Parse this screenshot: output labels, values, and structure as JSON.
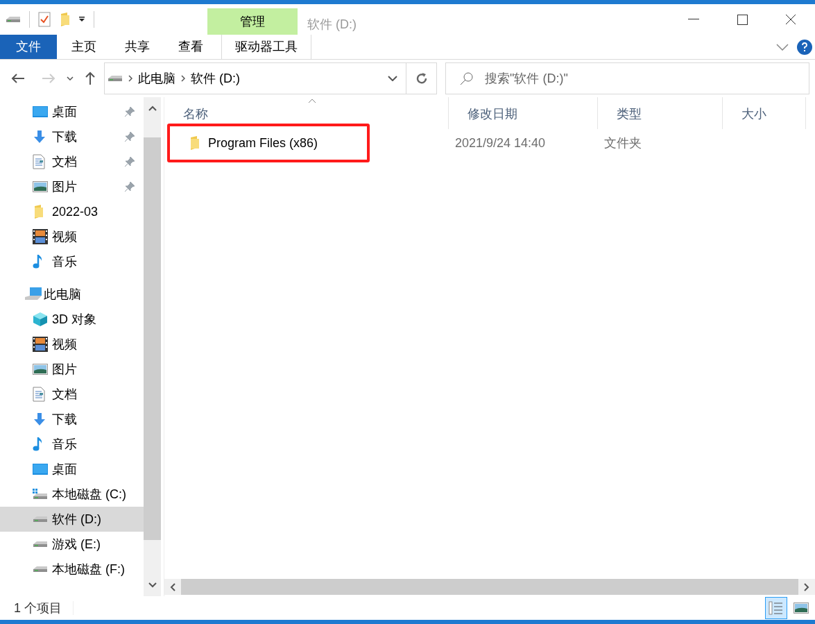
{
  "window": {
    "title": "软件 (D:)",
    "context_group": "管理"
  },
  "ribbon_tabs": [
    {
      "label": "文件",
      "kind": "file"
    },
    {
      "label": "主页",
      "kind": "normal"
    },
    {
      "label": "共享",
      "kind": "normal"
    },
    {
      "label": "查看",
      "kind": "normal"
    },
    {
      "label": "驱动器工具",
      "kind": "context"
    }
  ],
  "address_bar": {
    "crumbs": [
      "此电脑",
      "软件 (D:)"
    ]
  },
  "search": {
    "placeholder": "搜索\"软件 (D:)\""
  },
  "sidebar": {
    "quick_access": [
      {
        "label": "桌面",
        "kind": "desktop",
        "pinned": true,
        "selected": false
      },
      {
        "label": "下载",
        "kind": "download",
        "pinned": true,
        "selected": false
      },
      {
        "label": "文档",
        "kind": "document",
        "pinned": true,
        "selected": false
      },
      {
        "label": "图片",
        "kind": "picture",
        "pinned": true,
        "selected": false
      },
      {
        "label": "2022-03",
        "kind": "folder",
        "pinned": false,
        "selected": false
      },
      {
        "label": "视频",
        "kind": "video",
        "pinned": false,
        "selected": false
      },
      {
        "label": "音乐",
        "kind": "music",
        "pinned": false,
        "selected": false
      }
    ],
    "this_pc": {
      "label": "此电脑",
      "kind": "pc",
      "selected": false,
      "children": [
        {
          "label": "3D 对象",
          "kind": "cube",
          "selected": false
        },
        {
          "label": "视频",
          "kind": "video",
          "selected": false
        },
        {
          "label": "图片",
          "kind": "picture",
          "selected": false
        },
        {
          "label": "文档",
          "kind": "document",
          "selected": false
        },
        {
          "label": "下载",
          "kind": "download",
          "selected": false
        },
        {
          "label": "音乐",
          "kind": "music",
          "selected": false
        },
        {
          "label": "桌面",
          "kind": "desktop",
          "selected": false
        },
        {
          "label": "本地磁盘 (C:)",
          "kind": "system-drive",
          "selected": false
        },
        {
          "label": "软件 (D:)",
          "kind": "drive",
          "selected": true
        },
        {
          "label": "游戏 (E:)",
          "kind": "drive",
          "selected": false
        },
        {
          "label": "本地磁盘 (F:)",
          "kind": "drive",
          "selected": false
        }
      ]
    }
  },
  "table": {
    "columns": [
      {
        "label": "名称",
        "sorted": true
      },
      {
        "label": "修改日期",
        "sorted": false
      },
      {
        "label": "类型",
        "sorted": false
      },
      {
        "label": "大小",
        "sorted": false
      }
    ],
    "rows": [
      {
        "name": "Program Files (x86)",
        "modified": "2021/9/24 14:40",
        "type": "文件夹",
        "highlighted": true
      }
    ]
  },
  "status_bar": {
    "text": "1 个项目",
    "views": [
      {
        "kind": "details",
        "selected": true
      },
      {
        "kind": "thumbnails",
        "selected": false
      }
    ]
  }
}
